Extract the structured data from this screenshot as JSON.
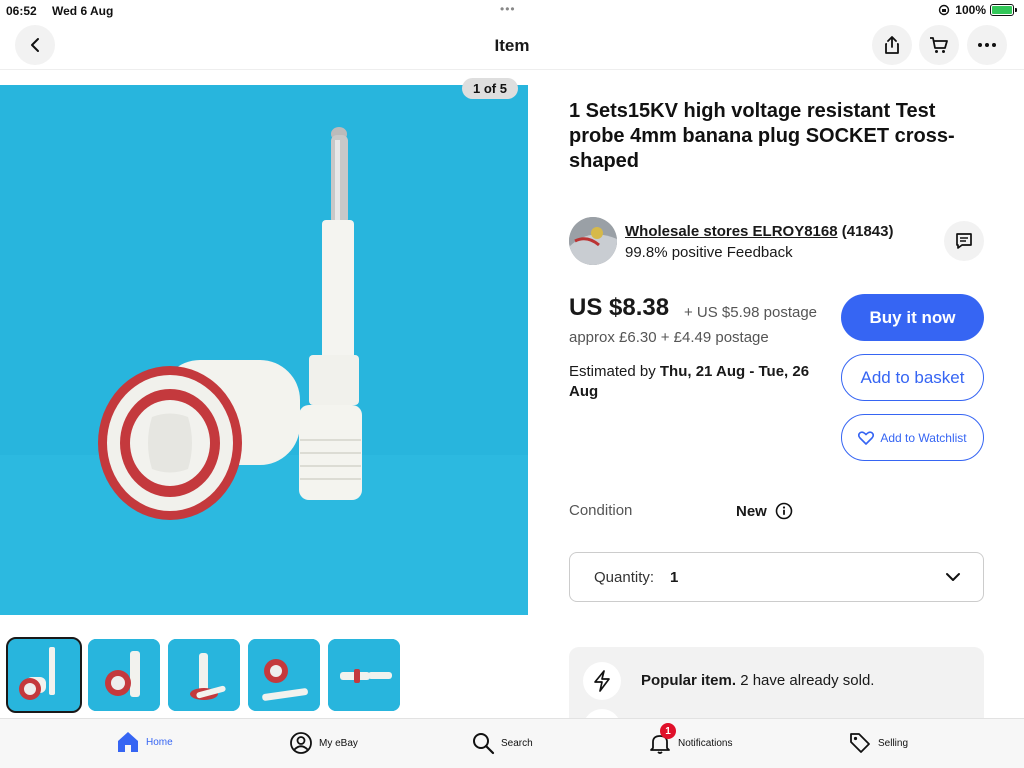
{
  "status_bar": {
    "time": "06:52",
    "date": "Wed 6 Aug",
    "battery": "100%"
  },
  "nav": {
    "title": "Item",
    "icons": [
      "back-icon",
      "share-icon",
      "cart-icon",
      "more-icon"
    ]
  },
  "gallery": {
    "counter": "1 of 5",
    "thumbnail_count": 5,
    "selected_index": 0
  },
  "item": {
    "title": "1 Sets15KV high voltage resistant Test probe 4mm banana plug SOCKET cross-shaped"
  },
  "seller": {
    "name": "Wholesale stores ELROY8168",
    "rating_count": "(41843)",
    "feedback": "99.8% positive Feedback"
  },
  "pricing": {
    "price": "US $8.38",
    "postage": "+ US $5.98 postage",
    "approx": "approx £6.30 + £4.49 postage",
    "estimated_prefix": "Estimated by",
    "estimated_dates": "Thu, 21 Aug - Tue, 26 Aug"
  },
  "actions": {
    "buy_now": "Buy it now",
    "add_to_basket": "Add to basket",
    "add_to_watchlist": "Add to Watchlist"
  },
  "condition": {
    "label": "Condition",
    "value": "New"
  },
  "quantity": {
    "label": "Quantity:",
    "value": "1"
  },
  "popular": {
    "bold": "Popular item.",
    "text": "2 have already sold."
  },
  "tabbar": {
    "home": "Home",
    "my_ebay": "My eBay",
    "search": "Search",
    "notifications": "Notifications",
    "notifications_badge": "1",
    "selling": "Selling"
  },
  "colors": {
    "accent": "#3665f3",
    "image_bg": "#28b5dd",
    "badge": "#e0102a"
  }
}
